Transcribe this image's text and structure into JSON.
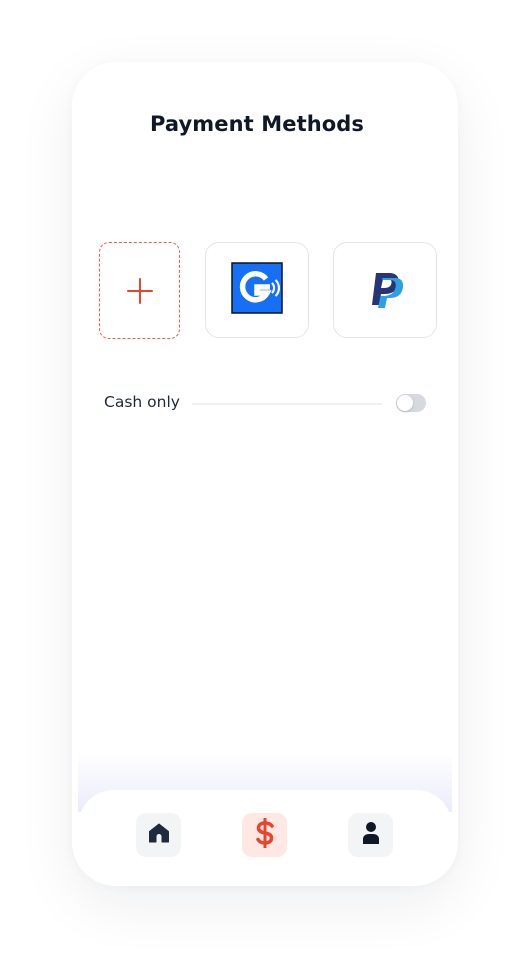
{
  "screen": {
    "title": "Payment Methods"
  },
  "payment_methods": {
    "add_label": "+",
    "items": [
      {
        "name": "Google Pay",
        "icon": "google-pay-icon"
      },
      {
        "name": "PayPal",
        "icon": "paypal-icon"
      }
    ]
  },
  "cash_only": {
    "label": "Cash only",
    "enabled": false
  },
  "nav": {
    "items": [
      {
        "icon": "home-icon",
        "active": false
      },
      {
        "icon": "dollar-icon",
        "active": true
      },
      {
        "icon": "user-icon",
        "active": false
      }
    ]
  },
  "colors": {
    "accent": "#E8452F",
    "title": "#101828",
    "nav_icon": "#1F2A3C",
    "active_bg": "#FDE8E4"
  }
}
